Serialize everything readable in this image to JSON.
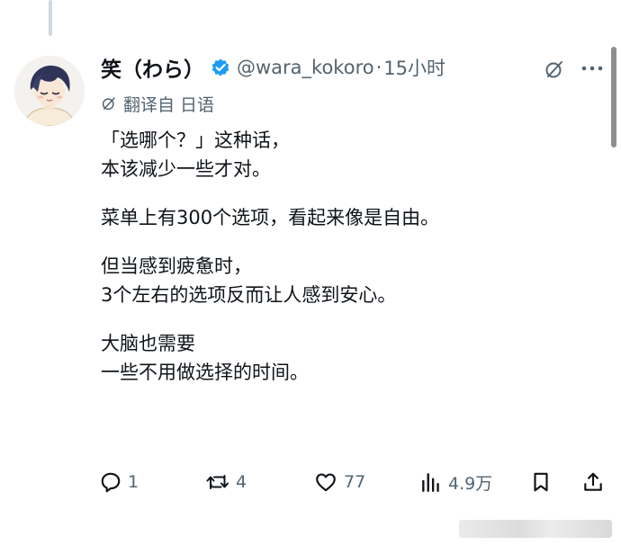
{
  "author": {
    "display_name": "笑（わら）",
    "handle": "@wara_kokoro",
    "separator": "·",
    "timestamp": "15小时",
    "verified": true,
    "verified_color": "#1d9bf0"
  },
  "translation_note": "翻译自 日语",
  "tweet": {
    "paragraphs": [
      [
        "「选哪个？」这种话，",
        "本该减少一些才对。"
      ],
      [
        "菜单上有300个选项，看起来像是自由。"
      ],
      [
        "但当感到疲惫时，",
        "3个左右的选项反而让人感到安心。"
      ],
      [
        "大脑也需要",
        "一些不用做选择的时间。"
      ]
    ]
  },
  "actions": {
    "replies": "1",
    "reposts": "4",
    "likes": "77",
    "views": "4.9万"
  },
  "icons": {
    "grok": "grok-icon",
    "more": "more-icon",
    "reply": "reply-icon",
    "repost": "repost-icon",
    "like": "heart-icon",
    "views": "views-icon",
    "bookmark": "bookmark-icon",
    "share": "share-icon"
  },
  "colors": {
    "text": "#0f1419",
    "secondary": "#536471",
    "accent": "#1d9bf0"
  }
}
